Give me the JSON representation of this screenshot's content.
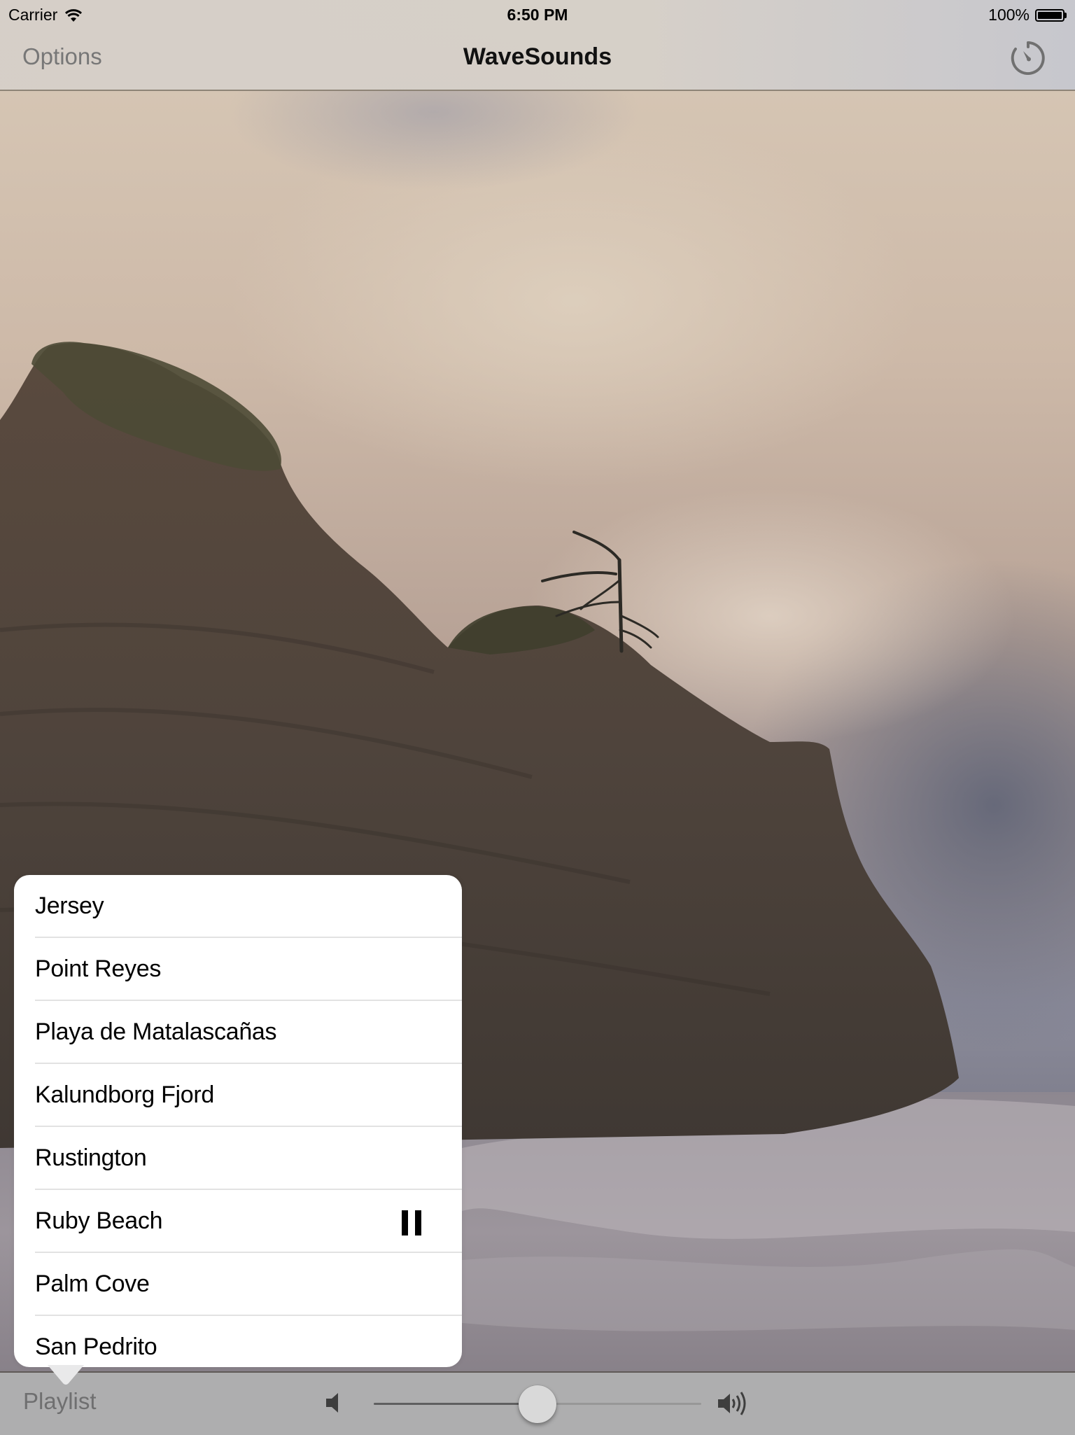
{
  "status_bar": {
    "carrier": "Carrier",
    "time": "6:50 PM",
    "battery_percent": "100%",
    "battery_level": 1.0,
    "wifi_icon": "wifi-icon",
    "battery_icon": "battery-icon"
  },
  "nav_bar": {
    "left_button": "Options",
    "title": "WaveSounds",
    "right_icon": "timer-icon"
  },
  "background": {
    "description": "Coastal cliff with wind-bent tree, cloudy sky and surf",
    "icon": "photo-background"
  },
  "playlist": {
    "items": [
      {
        "label": "Jersey",
        "playing": false
      },
      {
        "label": "Point Reyes",
        "playing": false
      },
      {
        "label": "Playa de Matalascañas",
        "playing": false
      },
      {
        "label": "Kalundborg Fjord",
        "playing": false
      },
      {
        "label": "Rustington",
        "playing": false
      },
      {
        "label": "Ruby Beach",
        "playing": true,
        "state_icon": "pause-icon"
      },
      {
        "label": "Palm Cove",
        "playing": false
      },
      {
        "label": "San Pedrito",
        "playing": false
      }
    ]
  },
  "toolbar": {
    "playlist_label": "Playlist",
    "volume": {
      "value": 0.5,
      "min_icon": "volume-low-icon",
      "max_icon": "volume-high-icon"
    }
  },
  "colors": {
    "nav_bar_bg": "#d6cfc8",
    "toolbar_bg": "#aeaeaf",
    "button_text": "#777777",
    "title_text": "#111111",
    "popover_bg": "#ffffff",
    "separator": "#e2e2e2",
    "slider_fill": "#5f5f60",
    "slider_track": "#979797",
    "slider_thumb": "#d9d9d9"
  }
}
